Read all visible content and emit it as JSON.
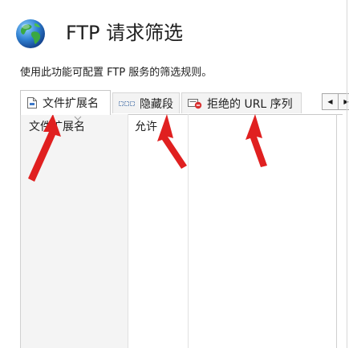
{
  "header": {
    "title": "FTP 请求筛选",
    "description": "使用此功能可配置 FTP 服务的筛选规则。",
    "icon": "globe-icon"
  },
  "tabs": [
    {
      "label": "文件扩展名",
      "icon": "file-extension-icon",
      "active": true
    },
    {
      "label": "隐藏段",
      "icon": "hidden-segment-icon",
      "active": false
    },
    {
      "label": "拒绝的 URL 序列",
      "icon": "denied-url-icon",
      "active": false
    }
  ],
  "tab_scroll": {
    "left": "◀",
    "right": "▶"
  },
  "table": {
    "columns": [
      "文件扩展名",
      "允许"
    ],
    "rows": []
  },
  "annotations": {
    "arrow_color": "#e02020"
  }
}
